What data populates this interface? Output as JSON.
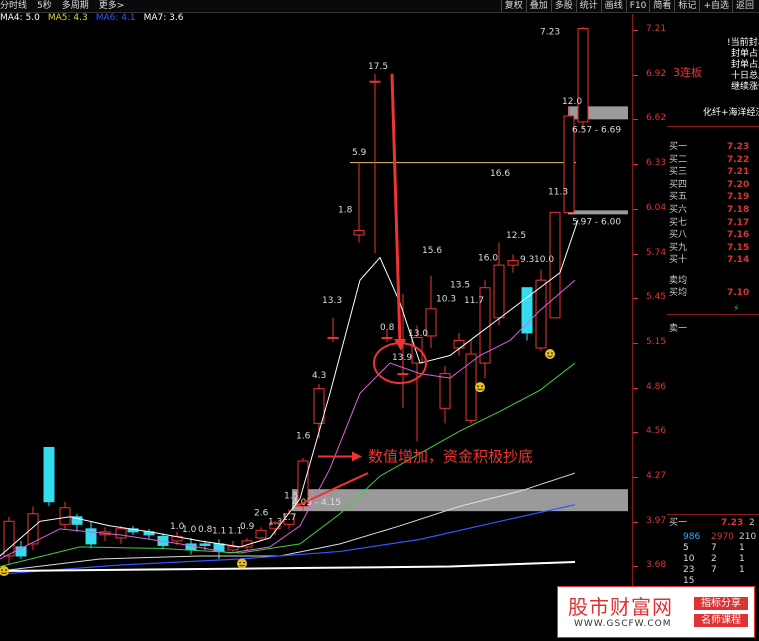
{
  "topbar": {
    "left": [
      "分时线",
      "5秒",
      "多周期",
      "更多>"
    ],
    "right": [
      "复权",
      "叠加",
      "多股",
      "统计",
      "画线",
      "F10",
      "简看",
      "标记",
      "+自选",
      "返回"
    ]
  },
  "ma": [
    {
      "label": "MA4: 5.0",
      "color": "#ffffff"
    },
    {
      "label": "MA5: 4.3",
      "color": "#dddd33"
    },
    {
      "label": "MA6: 4.1",
      "color": "#3355ff"
    },
    {
      "label": "MA7: 3.6",
      "color": "#ffffff"
    }
  ],
  "axis_ticks": [
    "7.21",
    "6.92",
    "6.62",
    "6.33",
    "6.04",
    "5.74",
    "5.45",
    "5.15",
    "4.86",
    "4.56",
    "4.27",
    "3.97",
    "3.68"
  ],
  "annotations": {
    "main": "数值增加，资金积极抄底",
    "zone_low": "4.03 - 4.15",
    "zone_mid": "5.97 - 6.00",
    "zone_high": "6.57 - 6.69"
  },
  "bar_labels": [
    "17.5",
    "5.9",
    "1.8",
    "13.3",
    "4.3",
    "0.8",
    "13.9",
    "13.0",
    "1.6",
    "1.5",
    "2.6",
    "1.3",
    "1.7",
    "0.9",
    "1.0",
    "1.0",
    "0.8",
    "1.1",
    "1.1",
    "15.6",
    "10.3",
    "13.5",
    "11.7",
    "16.0",
    "12.5",
    "9.3",
    "10.0",
    "11.3",
    "12.0",
    "16.6",
    "7.23"
  ],
  "right_panel": {
    "notes": [
      "!当前封单",
      "封单占比",
      "封单占成",
      "十日总成",
      "继续涨停"
    ],
    "limit_tag": "3连板",
    "concept": "化纤+海洋经济",
    "order_book": [
      {
        "label": "买一",
        "price": "7.23",
        "vol": ""
      },
      {
        "label": "买二",
        "price": "7.22",
        "vol": ""
      },
      {
        "label": "买三",
        "price": "7.21",
        "vol": ""
      },
      {
        "label": "买四",
        "price": "7.20",
        "vol": ""
      },
      {
        "label": "买五",
        "price": "7.19",
        "vol": ""
      },
      {
        "label": "买六",
        "price": "7.18",
        "vol": ""
      },
      {
        "label": "买七",
        "price": "7.17",
        "vol": ""
      },
      {
        "label": "买八",
        "price": "7.16",
        "vol": ""
      },
      {
        "label": "买九",
        "price": "7.15",
        "vol": ""
      },
      {
        "label": "买十",
        "price": "7.14",
        "vol": ""
      }
    ],
    "sell_avg": "卖均",
    "buy_avg": {
      "label": "买均",
      "price": "7.10"
    },
    "sell_one": "卖一",
    "buy_one": {
      "label": "买一",
      "price": "7.23",
      "vol": "2"
    },
    "grid": [
      [
        "986",
        "2970",
        "210"
      ],
      [
        "5",
        "7",
        "1"
      ],
      [
        "10",
        "2",
        "1"
      ],
      [
        "23",
        "7",
        "1"
      ],
      [
        "15",
        "",
        ""
      ]
    ]
  },
  "logo": {
    "title": "股市财富网",
    "url": "WWW.GSCFW.COM",
    "badge1": "指标分享",
    "badge2": "名师课程"
  },
  "colors": {
    "up": "#e33",
    "down": "#3de",
    "axis_red": "#d33"
  }
}
